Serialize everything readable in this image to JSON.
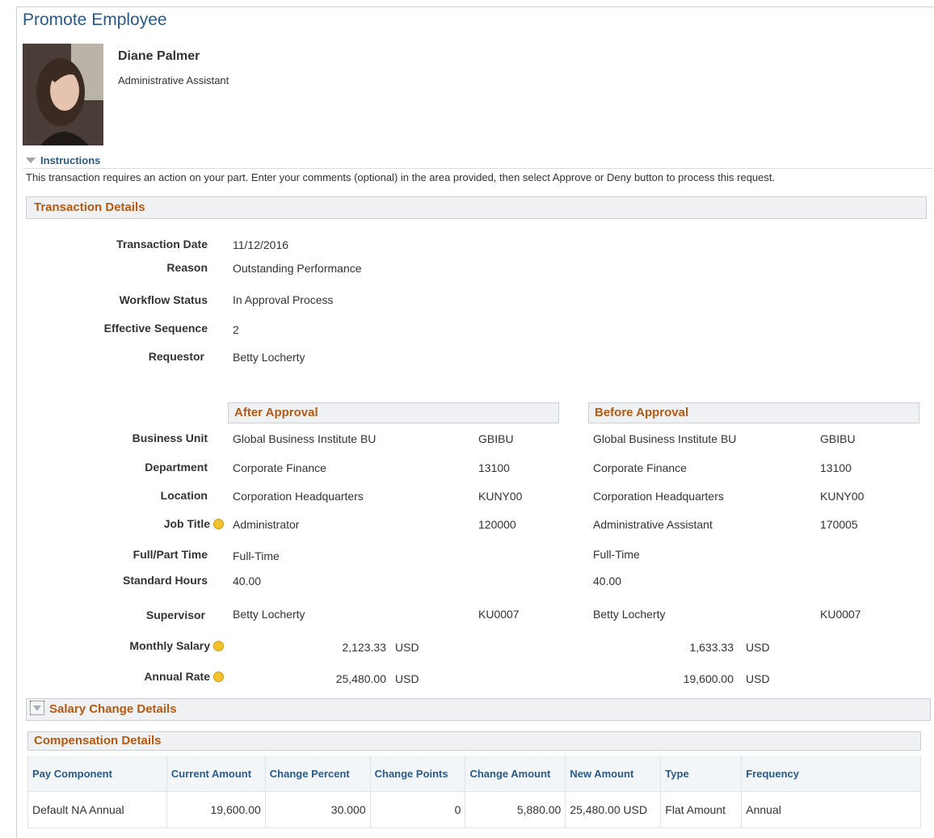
{
  "page": {
    "title": "Promote Employee"
  },
  "employee": {
    "name": "Diane Palmer",
    "job_title": "Administrative Assistant"
  },
  "instructions": {
    "label": "Instructions",
    "text": "This transaction requires an action on your part. Enter your comments (optional) in the area provided, then select Approve or Deny button to process this request."
  },
  "transaction": {
    "section_title": "Transaction Details",
    "fields": {
      "transaction_date": {
        "label": "Transaction Date",
        "value": "11/12/2016"
      },
      "reason": {
        "label": "Reason",
        "value": "Outstanding Performance"
      },
      "workflow_status": {
        "label": "Workflow Status",
        "value": "In Approval Process"
      },
      "effective_sequence": {
        "label": "Effective Sequence",
        "value": "2"
      },
      "requestor": {
        "label": "Requestor",
        "value": "Betty Locherty"
      }
    }
  },
  "comparison": {
    "after_title": "After Approval",
    "before_title": "Before Approval",
    "rows": [
      {
        "label": "Business Unit",
        "after": "Global Business Institute BU",
        "after_code": "GBIBU",
        "before": "Global Business Institute BU",
        "before_code": "GBIBU"
      },
      {
        "label": "Department",
        "after": "Corporate Finance",
        "after_code": "13100",
        "before": "Corporate Finance",
        "before_code": "13100"
      },
      {
        "label": "Location",
        "after": "Corporation Headquarters",
        "after_code": "KUNY00",
        "before": "Corporation Headquarters",
        "before_code": "KUNY00"
      },
      {
        "label": "Job Title",
        "after": "Administrator",
        "after_code": "120000",
        "before": "Administrative Assistant",
        "before_code": "170005"
      },
      {
        "label": "Full/Part Time",
        "after": "Full-Time",
        "after_code": "",
        "before": "Full-Time",
        "before_code": ""
      },
      {
        "label": "Standard Hours",
        "after": "40.00",
        "after_code": "",
        "before": "40.00",
        "before_code": ""
      },
      {
        "label": "Supervisor",
        "after": "Betty Locherty",
        "after_code": "KU0007",
        "before": "Betty Locherty",
        "before_code": "KU0007"
      },
      {
        "label": "Monthly Salary",
        "after": "2,123.33",
        "after_code": "USD",
        "before": "1,633.33",
        "before_code": "USD"
      },
      {
        "label": "Annual Rate",
        "after": "25,480.00",
        "after_code": "USD",
        "before": "19,600.00",
        "before_code": "USD"
      }
    ]
  },
  "salary_change": {
    "section_title": "Salary Change Details"
  },
  "compensation": {
    "title": "Compensation Details",
    "columns": [
      "Pay Component",
      "Current Amount",
      "Change Percent",
      "Change Points",
      "Change Amount",
      "New Amount",
      "Type",
      "Frequency"
    ],
    "rows": [
      [
        "Default NA Annual",
        "19,600.00",
        "30.000",
        "0",
        "5,880.00",
        "25,480.00 USD",
        "Flat Amount",
        "Annual"
      ]
    ]
  },
  "colors": {
    "title": "#2a5a8a",
    "section_text": "#b55a12",
    "changed_indicator": "#f2c12e"
  }
}
